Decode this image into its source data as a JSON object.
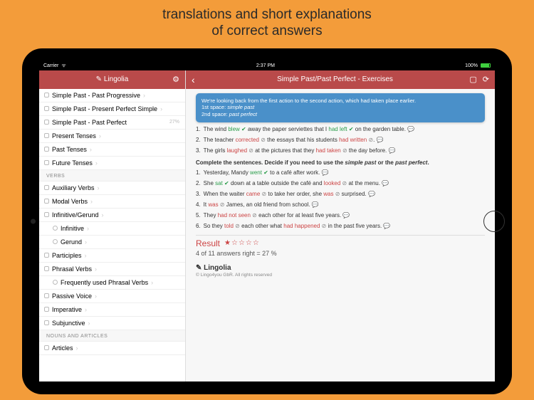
{
  "promo": {
    "line1": "translations and short explanations",
    "line2": "of correct answers"
  },
  "statusbar": {
    "carrier": "Carrier",
    "wifi": "ᯤ",
    "time": "2:37 PM",
    "battery": "100%"
  },
  "sidebar": {
    "brand": "Lingolia",
    "items_top": [
      {
        "label": "Simple Past - Past Progressive",
        "chev": true
      },
      {
        "label": "Simple Past - Present Perfect Simple",
        "chev": true
      },
      {
        "label": "Simple Past - Past Perfect",
        "pct": "27%"
      },
      {
        "label": "Present Tenses",
        "chev": true
      },
      {
        "label": "Past Tenses",
        "chev": true
      },
      {
        "label": "Future Tenses",
        "chev": true
      }
    ],
    "section_verbs": "VERBS",
    "items_verbs": [
      {
        "label": "Auxiliary Verbs",
        "chev": true
      },
      {
        "label": "Modal Verbs",
        "chev": true
      },
      {
        "label": "Infinitive/Gerund",
        "chev": true
      },
      {
        "label": "Infinitive",
        "chev": true,
        "sub": true
      },
      {
        "label": "Gerund",
        "chev": true,
        "sub": true
      },
      {
        "label": "Participles",
        "chev": true
      },
      {
        "label": "Phrasal Verbs",
        "chev": true
      },
      {
        "label": "Frequently used Phrasal Verbs",
        "chev": true,
        "sub": true
      },
      {
        "label": "Passive Voice",
        "chev": true
      },
      {
        "label": "Imperative",
        "chev": true
      },
      {
        "label": "Subjunctive",
        "chev": true
      }
    ],
    "section_nouns": "NOUNS AND ARTICLES",
    "items_nouns": [
      {
        "label": "Articles",
        "chev": true
      }
    ]
  },
  "content": {
    "title": "Simple Past/Past Perfect - Exercises",
    "explain": {
      "l1": "We're looking back from the first action to the second action, which had taken place earlier.",
      "l2a": "1st space:",
      "l2b": "simple past",
      "l3a": "2nd space:",
      "l3b": "past perfect"
    },
    "set1": [
      {
        "n": "1.",
        "pre": "The wind ",
        "w": "blew",
        "wc": "correct",
        "m1": "✔",
        "mid": " away the paper serviettes that I ",
        "w2": "had left",
        "w2c": "correct",
        "m2": "✔",
        "post": " on the garden table.",
        "sp": true
      },
      {
        "n": "2.",
        "pre": "The teacher ",
        "w": "corrected",
        "wc": "wrong",
        "m1": "⊘",
        "mid": " the essays that his students ",
        "w2": "had written",
        "w2c": "wrong",
        "m2": "⊘",
        "post": ".",
        "sp": true
      },
      {
        "n": "3.",
        "pre": "The girls ",
        "w": "laughed",
        "wc": "wrong",
        "m1": "⊘",
        "mid": " at the pictures that they ",
        "w2": "had taken",
        "w2c": "wrong",
        "m2": "⊘",
        "post": " the day before.",
        "sp": true
      }
    ],
    "instr": {
      "a": "Complete the sentences. Decide if you need to use the ",
      "b": "simple past",
      "c": " or the ",
      "d": "past perfect",
      "e": "."
    },
    "set2": [
      {
        "n": "1.",
        "parts": [
          {
            "t": "Yesterday, Mandy "
          },
          {
            "t": "went",
            "c": "correct"
          },
          {
            "t": " ✔",
            "c": "check"
          },
          {
            "t": " to a café after work."
          }
        ],
        "sp": true
      },
      {
        "n": "2.",
        "parts": [
          {
            "t": "She "
          },
          {
            "t": "sat",
            "c": "correct"
          },
          {
            "t": " ✔",
            "c": "check"
          },
          {
            "t": " down at a table outside the café and "
          },
          {
            "t": "looked",
            "c": "wrong"
          },
          {
            "t": " ⊘",
            "c": "clock"
          },
          {
            "t": " at the menu."
          }
        ],
        "sp": true
      },
      {
        "n": "3.",
        "parts": [
          {
            "t": "When the waiter "
          },
          {
            "t": "came",
            "c": "wrong"
          },
          {
            "t": " ⊘",
            "c": "clock"
          },
          {
            "t": " to take her order, she "
          },
          {
            "t": "was",
            "c": "wrong"
          },
          {
            "t": " ⊘",
            "c": "clock"
          },
          {
            "t": " surprised."
          }
        ],
        "sp": true
      },
      {
        "n": "4.",
        "parts": [
          {
            "t": "It "
          },
          {
            "t": "was",
            "c": "wrong"
          },
          {
            "t": " ⊘",
            "c": "clock"
          },
          {
            "t": " James, an old friend from school."
          }
        ],
        "sp": true
      },
      {
        "n": "5.",
        "parts": [
          {
            "t": "They  "
          },
          {
            "t": "had not seen",
            "c": "wrong"
          },
          {
            "t": " ⊘",
            "c": "clock"
          },
          {
            "t": " each other for at least five years."
          }
        ],
        "sp": true
      },
      {
        "n": "6.",
        "parts": [
          {
            "t": "So they "
          },
          {
            "t": "told",
            "c": "wrong"
          },
          {
            "t": " ⊘",
            "c": "clock"
          },
          {
            "t": " each other what "
          },
          {
            "t": "had happened",
            "c": "wrong"
          },
          {
            "t": " ⊘",
            "c": "clock"
          },
          {
            "t": " in the past five years."
          }
        ],
        "sp": true
      }
    ],
    "result": {
      "label": "Result",
      "stars_filled": 1,
      "stars_total": 5,
      "score": "4 of 11 answers right = 27 %"
    },
    "footer": {
      "brand": "Lingolia",
      "copy": "© Lingo4you GbR. All rights reserved"
    }
  }
}
